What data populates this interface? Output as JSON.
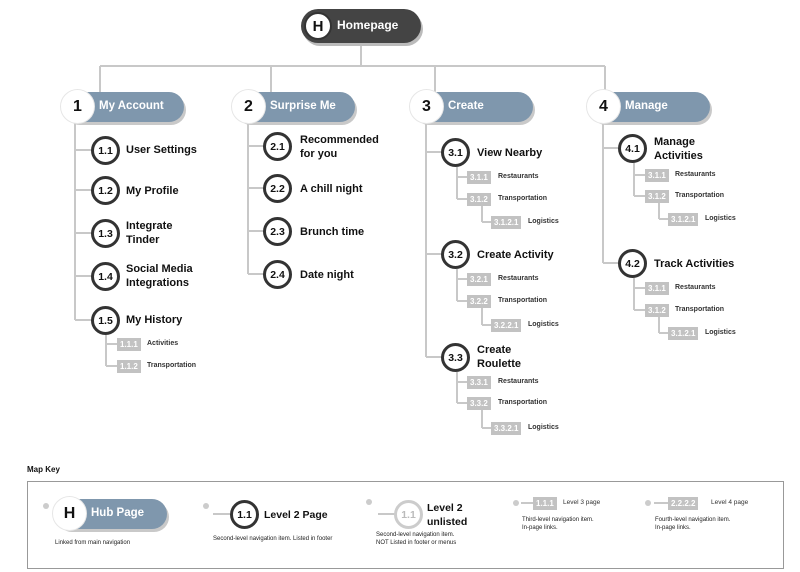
{
  "home": {
    "icon": "H",
    "label": "Homepage"
  },
  "hubs": [
    {
      "num": "1",
      "label": "My Account"
    },
    {
      "num": "2",
      "label": "Surprise Me"
    },
    {
      "num": "3",
      "label": "Create"
    },
    {
      "num": "4",
      "label": "Manage"
    }
  ],
  "col1": [
    {
      "num": "1.1",
      "label": "User Settings"
    },
    {
      "num": "1.2",
      "label": "My Profile"
    },
    {
      "num": "1.3",
      "label": "Integrate Tinder"
    },
    {
      "num": "1.4",
      "label": "Social Media Integrations"
    },
    {
      "num": "1.5",
      "label": "My History"
    }
  ],
  "col1_sub": [
    {
      "num": "1.1.1",
      "label": "Activities"
    },
    {
      "num": "1.1.2",
      "label": "Transportation"
    }
  ],
  "col2": [
    {
      "num": "2.1",
      "label": "Recommended for you"
    },
    {
      "num": "2.2",
      "label": "A chill night"
    },
    {
      "num": "2.3",
      "label": "Brunch time"
    },
    {
      "num": "2.4",
      "label": "Date night"
    }
  ],
  "col3": [
    {
      "num": "3.1",
      "label": "View Nearby",
      "subs": [
        {
          "num": "3.1.1",
          "label": "Restaurants"
        },
        {
          "num": "3.1.2",
          "label": "Transportation"
        }
      ],
      "l4": {
        "num": "3.1.2.1",
        "label": "Logistics"
      }
    },
    {
      "num": "3.2",
      "label": "Create Activity",
      "subs": [
        {
          "num": "3.2.1",
          "label": "Restaurants"
        },
        {
          "num": "3.2.2",
          "label": "Transportation"
        }
      ],
      "l4": {
        "num": "3.2.2.1",
        "label": "Logistics"
      }
    },
    {
      "num": "3.3",
      "label": "Create Roulette",
      "subs": [
        {
          "num": "3.3.1",
          "label": "Restaurants"
        },
        {
          "num": "3.3.2",
          "label": "Transportation"
        }
      ],
      "l4": {
        "num": "3.3.2.1",
        "label": "Logistics"
      }
    }
  ],
  "col4": [
    {
      "num": "4.1",
      "label": "Manage Activities",
      "subs": [
        {
          "num": "3.1.1",
          "label": "Restaurants"
        },
        {
          "num": "3.1.2",
          "label": "Transportation"
        }
      ],
      "l4": {
        "num": "3.1.2.1",
        "label": "Logistics"
      }
    },
    {
      "num": "4.2",
      "label": "Track Activities",
      "subs": [
        {
          "num": "3.1.1",
          "label": "Restaurants"
        },
        {
          "num": "3.1.2",
          "label": "Transportation"
        }
      ],
      "l4": {
        "num": "3.1.2.1",
        "label": "Logistics"
      }
    }
  ],
  "key": {
    "title": "Map Key",
    "hub": {
      "icon": "H",
      "label": "Hub Page",
      "desc": "Linked from main navigation"
    },
    "l2": {
      "num": "1.1",
      "label": "Level 2 Page",
      "desc": "Second-level navigation item. Listed in footer"
    },
    "l2u": {
      "num": "1.1",
      "label": "Level 2 unlisted",
      "desc1": "Second-level navigation item.",
      "desc2": "NOT Listed in footer or menus"
    },
    "l3": {
      "num": "1.1.1",
      "label": "Level 3 page",
      "desc1": "Third-level navigation item.",
      "desc2": "In-page links."
    },
    "l4": {
      "num": "2.2.2.2",
      "label": "Level 4 page",
      "desc1": "Fourth-level navigation item.",
      "desc2": "In-page links."
    }
  }
}
